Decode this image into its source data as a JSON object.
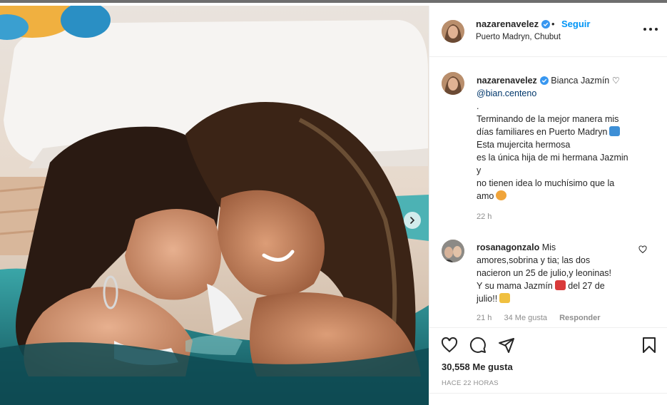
{
  "post": {
    "author": "nazarenavelez",
    "follow_label": "Seguir",
    "dot": "•",
    "location": "Puerto Madryn, Chubut"
  },
  "caption": {
    "username": "nazarenavelez",
    "lines": [
      "Bianca Jazmín ♡",
      "@bian.centeno",
      ".",
      "Terminando de la mejor manera mis",
      "días familiares en Puerto Madryn",
      "Esta mujercita hermosa",
      "es la única hija de mi hermana Jazmin",
      "y",
      "no tienen idea lo muchísimo que la",
      "amo"
    ],
    "time": "22 h"
  },
  "comment": {
    "username": "rosanagonzalo",
    "lines": [
      "Mis",
      "amores,sobrina y tia; las dos",
      "nacieron un 25 de julio,y leoninas!",
      "Y su mama Jazmín",
      "del 27 de",
      "julio!!"
    ],
    "time": "21 h",
    "likes": "34 Me gusta",
    "reply": "Responder"
  },
  "actions": {
    "likes": "30,558 Me gusta",
    "time": "HACE 22 HORAS"
  },
  "icons": {
    "verified": "verified-badge-icon",
    "more": "more-options-icon",
    "like": "heart-icon",
    "comment": "comment-icon",
    "share": "paper-plane-icon",
    "save": "bookmark-icon",
    "next": "chevron-right-icon"
  },
  "colors": {
    "link": "#0095f6",
    "verified": "#3897f0",
    "muted": "#8e8e8e",
    "text": "#262626",
    "mention": "#00376b"
  }
}
